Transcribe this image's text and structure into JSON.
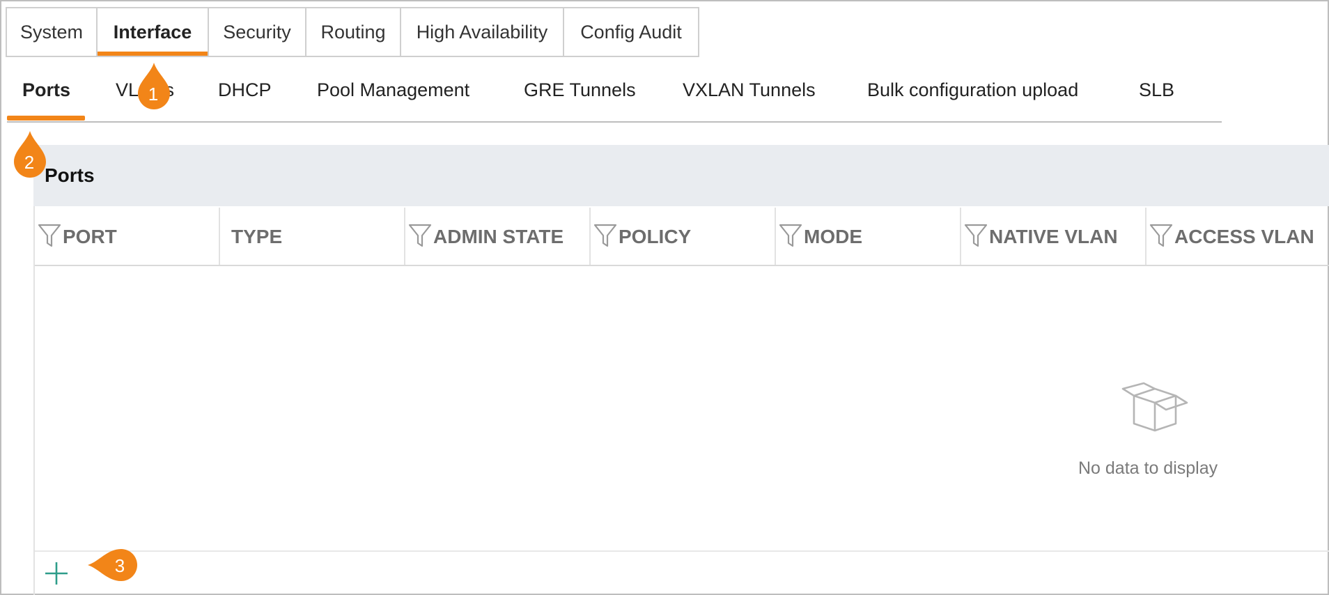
{
  "top_tabs": [
    {
      "label": "System"
    },
    {
      "label": "Interface"
    },
    {
      "label": "Security"
    },
    {
      "label": "Routing"
    },
    {
      "label": "High Availability"
    },
    {
      "label": "Config Audit"
    }
  ],
  "sub_tabs": [
    {
      "label": "Ports"
    },
    {
      "label": "VLANs"
    },
    {
      "label": "DHCP"
    },
    {
      "label": "Pool Management"
    },
    {
      "label": "GRE Tunnels"
    },
    {
      "label": "VXLAN Tunnels"
    },
    {
      "label": "Bulk configuration upload"
    },
    {
      "label": "SLB"
    }
  ],
  "panel": {
    "title": "Ports",
    "columns": [
      {
        "label": "PORT"
      },
      {
        "label": "TYPE"
      },
      {
        "label": "ADMIN STATE"
      },
      {
        "label": "POLICY"
      },
      {
        "label": "MODE"
      },
      {
        "label": "NATIVE VLAN"
      },
      {
        "label": "ACCESS VLAN"
      }
    ],
    "empty_text": "No data to display"
  },
  "markers": [
    "1",
    "2",
    "3"
  ],
  "colors": {
    "accent": "#f28518",
    "add_icon": "#2e9d8a"
  }
}
